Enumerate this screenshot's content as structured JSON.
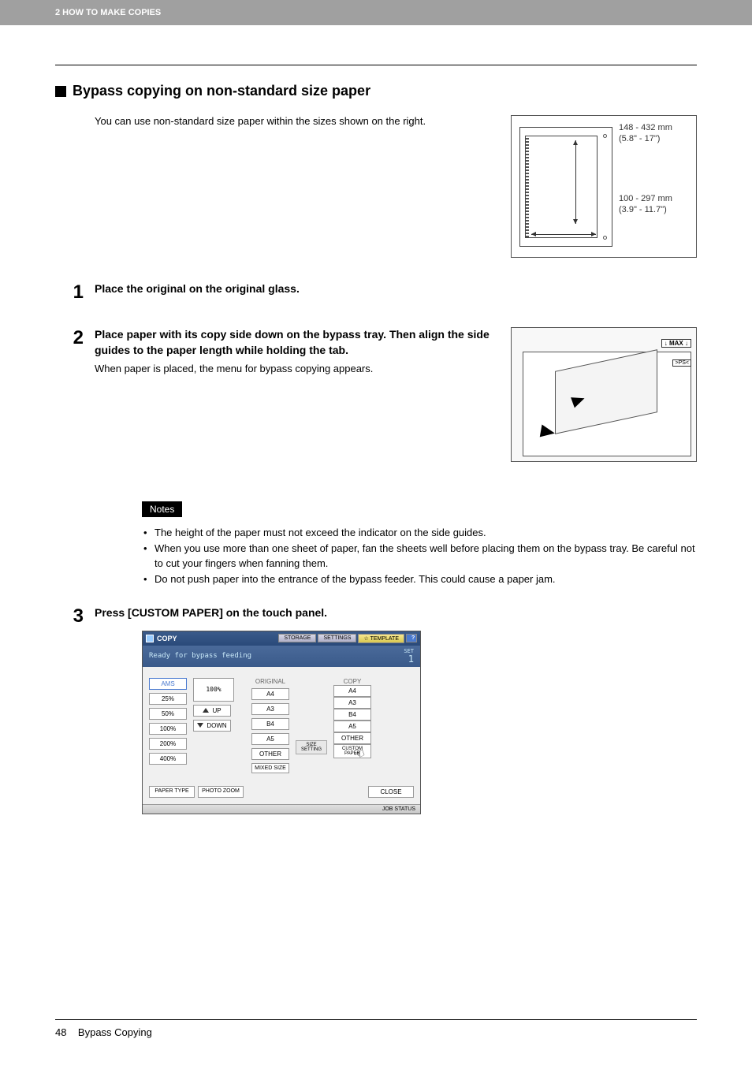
{
  "header": {
    "chapter": "2 HOW TO MAKE COPIES"
  },
  "section": {
    "title": "Bypass copying on non-standard size paper"
  },
  "intro": "You can use non-standard size paper within the sizes shown on the right.",
  "diagram_a": {
    "width_label": "148 - 432 mm",
    "width_imperial": "(5.8\" - 17\")",
    "height_label": "100 - 297 mm",
    "height_imperial": "(3.9\" - 11.7\")"
  },
  "steps": {
    "s1": {
      "num": "1",
      "title": "Place the original on the original glass."
    },
    "s2": {
      "num": "2",
      "title": "Place paper with its copy side down on the bypass tray. Then align the side guides to the paper length while holding the tab.",
      "body": "When paper is placed, the menu for bypass copying appears."
    },
    "s3": {
      "num": "3",
      "title": "Press [CUSTOM PAPER] on the touch panel."
    }
  },
  "diagram_b": {
    "max": "↓ MAX ↓",
    "ps": ">PS<"
  },
  "notes": {
    "label": "Notes",
    "items": [
      "The height of the paper must not exceed the indicator on the side guides.",
      "When you use more than one sheet of paper, fan the sheets well before placing them on the bypass tray. Be careful not to cut your fingers when fanning them.",
      "Do not push paper into the entrance of the bypass feeder. This could cause a paper jam."
    ]
  },
  "panel": {
    "mode": "COPY",
    "tabs": {
      "storage": "STORAGE",
      "settings": "SETTINGS",
      "template": "TEMPLATE",
      "help": "?"
    },
    "status": "Ready for bypass feeding",
    "set_label": "SET",
    "set_count": "1",
    "zoom": {
      "ams": "AMS",
      "p25": "25%",
      "p50": "50%",
      "p100": "100%",
      "p200": "200%",
      "p400": "400%",
      "current": "100%",
      "up": "UP",
      "down": "DOWN"
    },
    "original": {
      "label": "ORIGINAL",
      "a4": "A4",
      "a3": "A3",
      "b4": "B4",
      "a5": "A5",
      "other": "OTHER",
      "mixed": "MIXED SIZE"
    },
    "size_setting": "SIZE SETTING",
    "copy": {
      "label": "COPY",
      "a4": "A4",
      "a3": "A3",
      "b4": "B4",
      "a5": "A5",
      "other": "OTHER",
      "custom": "CUSTOM PAPER"
    },
    "bottom": {
      "paper_type": "PAPER TYPE",
      "photo_zoom": "PHOTO ZOOM",
      "close": "CLOSE"
    },
    "job_status": "JOB STATUS"
  },
  "footer": {
    "page": "48",
    "title": "Bypass Copying"
  }
}
